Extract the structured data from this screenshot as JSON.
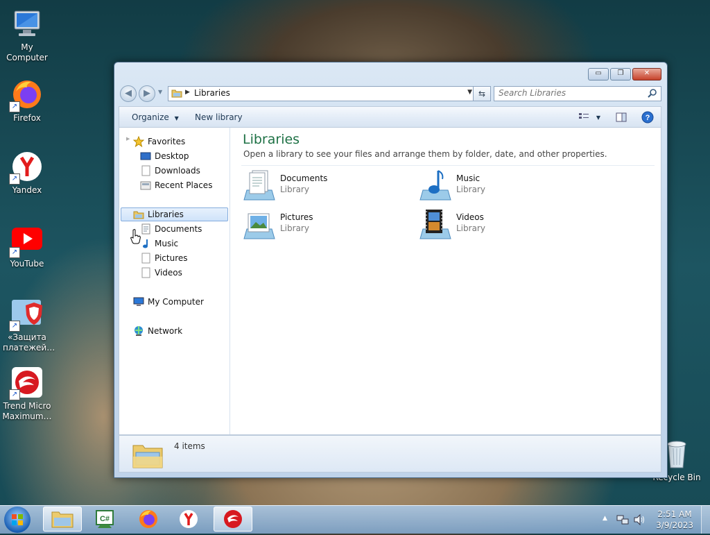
{
  "desktop": {
    "icons": [
      {
        "label": "My Computer",
        "icon": "computer-icon"
      },
      {
        "label": "Firefox",
        "icon": "firefox-icon"
      },
      {
        "label": "Yandex",
        "icon": "yandex-icon"
      },
      {
        "label": "YouTube",
        "icon": "youtube-icon"
      },
      {
        "label": "«Защита платежей…",
        "icon": "payment-protection-icon"
      },
      {
        "label": "Trend Micro Maximum…",
        "icon": "trend-micro-icon"
      },
      {
        "label": "Recycle Bin",
        "icon": "recycle-bin-icon"
      }
    ]
  },
  "window": {
    "title_buttons": {
      "minimize": "▭",
      "maximize": "❐",
      "close": "✕"
    },
    "address": {
      "breadcrumb": "Libraries"
    },
    "search": {
      "placeholder": "Search Libraries"
    },
    "toolbar": {
      "organize": "Organize",
      "new_library": "New library"
    },
    "nav": {
      "favorites": "Favorites",
      "favorites_items": [
        "Desktop",
        "Downloads",
        "Recent Places"
      ],
      "libraries": "Libraries",
      "libraries_items": [
        "Documents",
        "Music",
        "Pictures",
        "Videos"
      ],
      "my_computer": "My Computer",
      "network": "Network"
    },
    "main": {
      "title": "Libraries",
      "subtitle": "Open a library to see your files and arrange them by folder, date, and other properties.",
      "libraries": [
        {
          "name": "Documents",
          "type": "Library",
          "icon": "documents-library-icon"
        },
        {
          "name": "Music",
          "type": "Library",
          "icon": "music-library-icon"
        },
        {
          "name": "Pictures",
          "type": "Library",
          "icon": "pictures-library-icon"
        },
        {
          "name": "Videos",
          "type": "Library",
          "icon": "videos-library-icon"
        }
      ]
    },
    "status": {
      "count": "4 items"
    }
  },
  "taskbar": {
    "clock_time": "2:51 AM",
    "clock_date": "3/9/2023",
    "apps": [
      "windows-explorer-icon",
      "csharp-editor-icon",
      "firefox-icon",
      "yandex-icon",
      "trend-micro-icon"
    ]
  },
  "colors": {
    "accent_title": "#1e7145",
    "selection": "#cfe3fa",
    "taskbar": "#7ca0c4"
  }
}
